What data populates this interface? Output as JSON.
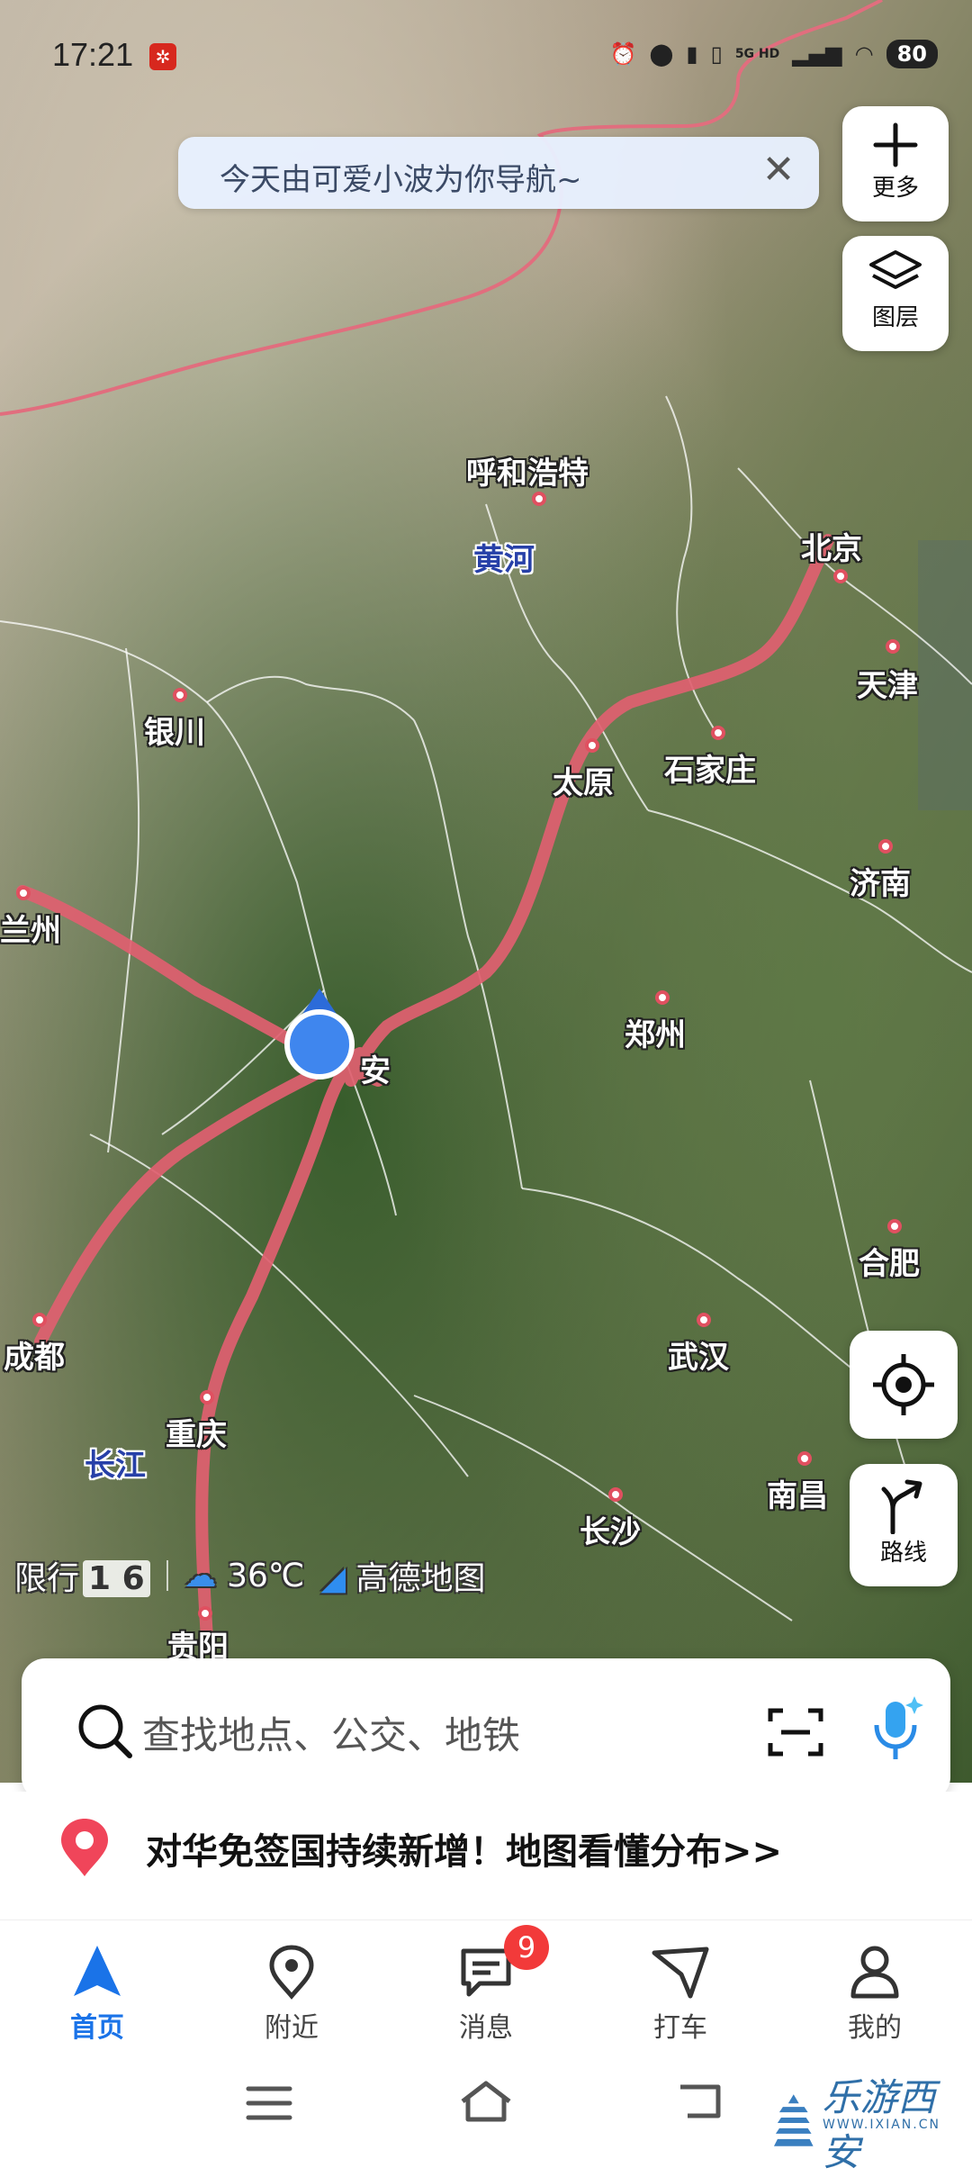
{
  "status_bar": {
    "time": "17:21",
    "network": "5G HD",
    "battery": "80"
  },
  "toast": {
    "text": "今天由可爱小波为你导航~",
    "close_icon": "close-icon"
  },
  "side_buttons": {
    "more_label": "更多",
    "layers_label": "图层",
    "locate_icon": "locate-icon",
    "route_label": "路线"
  },
  "map": {
    "route_color": "#e06070",
    "cities": [
      {
        "name": "呼和浩特"
      },
      {
        "name": "北京"
      },
      {
        "name": "天津"
      },
      {
        "name": "银川"
      },
      {
        "name": "太原"
      },
      {
        "name": "石家庄"
      },
      {
        "name": "兰州"
      },
      {
        "name": "济南"
      },
      {
        "name": "郑州"
      },
      {
        "name": "安"
      },
      {
        "name": "合肥"
      },
      {
        "name": "成都"
      },
      {
        "name": "武汉"
      },
      {
        "name": "重庆"
      },
      {
        "name": "南昌"
      },
      {
        "name": "长沙"
      },
      {
        "name": "贵阳"
      }
    ],
    "rivers": [
      "黄河",
      "长江"
    ]
  },
  "info_bar": {
    "restriction_label": "限行",
    "restriction_numbers": "1 6",
    "weather_icon": "cloud-icon",
    "temperature": "36℃",
    "brand": "高德地图"
  },
  "search": {
    "placeholder": "查找地点、公交、地铁"
  },
  "promo": {
    "text": "对华免签国持续新增！地图看懂分布>>"
  },
  "tabs": [
    {
      "label": "首页",
      "active": true
    },
    {
      "label": "附近",
      "active": false
    },
    {
      "label": "消息",
      "active": false,
      "badge": "9"
    },
    {
      "label": "打车",
      "active": false
    },
    {
      "label": "我的",
      "active": false
    }
  ],
  "watermark": {
    "cn": "乐游西安",
    "url": "WWW.IXIAN.CN"
  }
}
